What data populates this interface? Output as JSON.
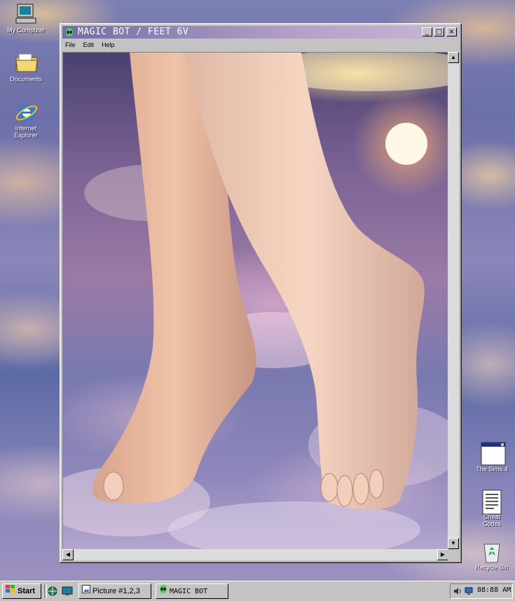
{
  "desktop": {
    "icons_left": [
      {
        "label": "My Computer",
        "icon": "computer-icon"
      },
      {
        "label": "Documents",
        "icon": "folder-icon"
      },
      {
        "label": "Internet Explorer",
        "icon": "ie-icon"
      }
    ],
    "icons_right": [
      {
        "label": "The Sims 4",
        "icon": "window-app-icon"
      },
      {
        "label": "Cheat Codes",
        "icon": "text-file-icon"
      },
      {
        "label": "Recycle Bin",
        "icon": "recycle-bin-icon"
      }
    ]
  },
  "window": {
    "title": "MAGIC BOT / FEET 6V",
    "title_icon": "alien-icon",
    "controls": [
      "_",
      "□",
      "×"
    ],
    "menu": [
      "File",
      "Edit",
      "Help"
    ],
    "image_description_icon": "feet-in-clouds-image"
  },
  "taskbar": {
    "start_label": "Start",
    "quick_launch": [
      "browser-globe-icon",
      "desktop-icon"
    ],
    "tasks": [
      {
        "label": "Picture #1,2,3",
        "icon": "picture-icon"
      },
      {
        "label": "MAGIC BOT",
        "icon": "alien-icon"
      }
    ],
    "clock": "88:88 AM",
    "tray_icons": [
      "speaker-icon",
      "monitor-icon"
    ]
  },
  "colors": {
    "window_gray": "#c3c3c3",
    "title_gradient_start": "#6f6fa6",
    "title_gradient_end": "#c9b6d6"
  }
}
